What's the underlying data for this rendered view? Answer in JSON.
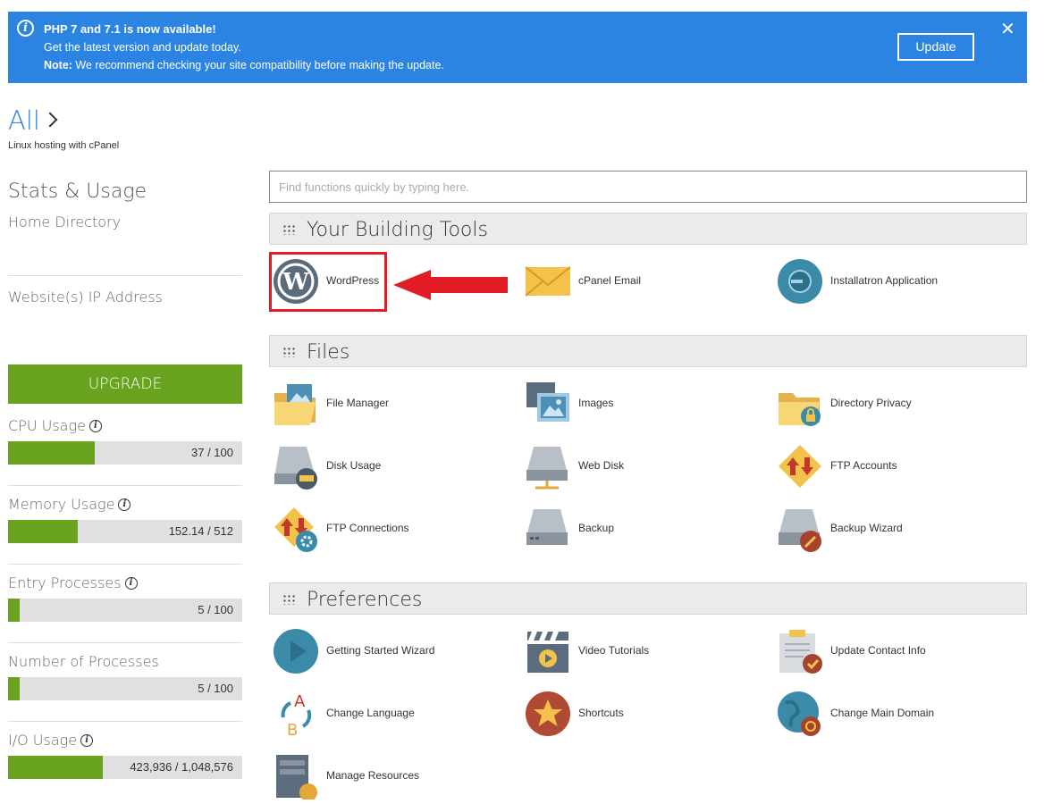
{
  "banner": {
    "title": "PHP 7 and 7.1 is now available!",
    "line": "Get the latest version and update today.",
    "note_label": "Note:",
    "note_text": " We recommend checking your site compatibility before making the update.",
    "update_label": "Update",
    "close_glyph": "✕"
  },
  "header": {
    "all_label": "All",
    "subtitle": "Linux hosting with cPanel"
  },
  "left_panel": {
    "stats_heading": "Stats & Usage",
    "home_directory": "Home Directory",
    "ip_address": "Website(s) IP Address",
    "upgrade_label": "UPGRADE",
    "stats": [
      {
        "label": "CPU Usage",
        "value_text": "37 / 100",
        "fraction": 0.37
      },
      {
        "label": "Memory Usage",
        "value_text": "152.14 / 512",
        "fraction": 0.297
      },
      {
        "label": "Entry Processes",
        "value_text": "5 / 100",
        "fraction": 0.05
      },
      {
        "label": "Number of Processes",
        "value_text": "5 / 100",
        "fraction": 0.05
      },
      {
        "label": "I/O Usage",
        "value_text": "423,936 / 1,048,576",
        "fraction": 0.404
      }
    ]
  },
  "search": {
    "placeholder": "Find functions quickly by typing here."
  },
  "sections": {
    "building": {
      "title": "Your Building Tools",
      "items": [
        {
          "label": "WordPress",
          "icon": "wordpress-icon"
        },
        {
          "label": "cPanel Email",
          "icon": "envelope-icon"
        },
        {
          "label": "Installatron Application",
          "icon": "installatron-icon"
        }
      ]
    },
    "files": {
      "title": "Files",
      "items": [
        {
          "label": "File Manager",
          "icon": "folder-image-icon"
        },
        {
          "label": "Images",
          "icon": "images-icon"
        },
        {
          "label": "Directory Privacy",
          "icon": "folder-lock-icon"
        },
        {
          "label": "Disk Usage",
          "icon": "disk-usage-icon"
        },
        {
          "label": "Web Disk",
          "icon": "web-disk-icon"
        },
        {
          "label": "FTP Accounts",
          "icon": "ftp-accounts-icon"
        },
        {
          "label": "FTP Connections",
          "icon": "ftp-connections-icon"
        },
        {
          "label": "Backup",
          "icon": "backup-icon"
        },
        {
          "label": "Backup Wizard",
          "icon": "backup-wizard-icon"
        }
      ]
    },
    "preferences": {
      "title": "Preferences",
      "items": [
        {
          "label": "Getting Started Wizard",
          "icon": "play-icon"
        },
        {
          "label": "Video Tutorials",
          "icon": "clapperboard-icon"
        },
        {
          "label": "Update Contact Info",
          "icon": "clipboard-check-icon"
        },
        {
          "label": "Change Language",
          "icon": "language-icon"
        },
        {
          "label": "Shortcuts",
          "icon": "star-icon"
        },
        {
          "label": "Change Main Domain",
          "icon": "globe-icon"
        },
        {
          "label": "Manage Resources",
          "icon": "server-gear-icon"
        }
      ]
    }
  },
  "colors": {
    "banner": "#2b84e2",
    "accent_green": "#6aa31f",
    "highlight_red": "#e21c24"
  }
}
